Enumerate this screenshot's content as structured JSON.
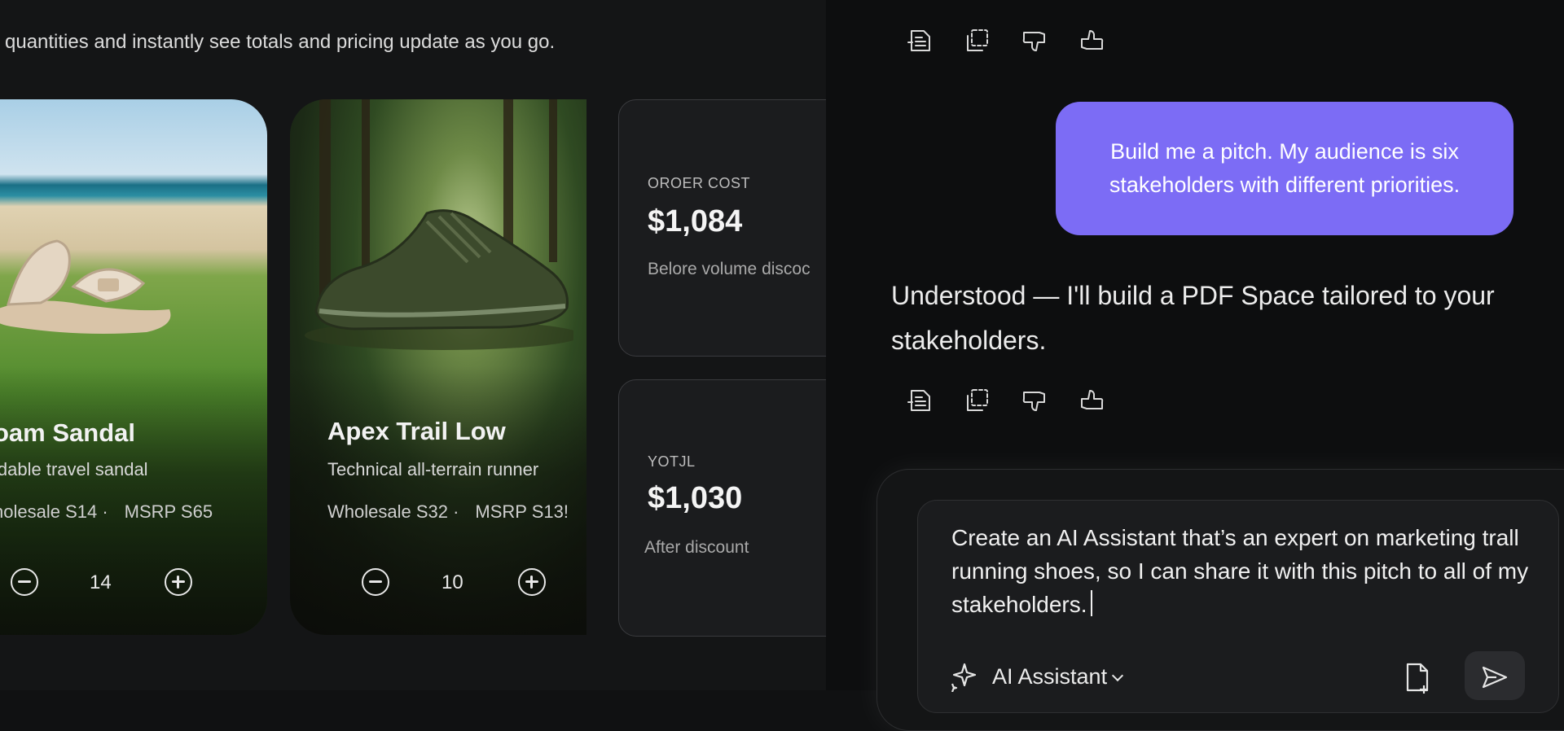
{
  "catalog": {
    "intro": "quantities and instantly see totals and pricing update as you go.",
    "products": [
      {
        "name": "oam Sandal",
        "description": "ldable travel sandal",
        "wholesale": "holesale S14 ·",
        "msrp": "MSRP S65",
        "quantity": "14"
      },
      {
        "name": "Apex Trail Low",
        "description": "Technical all-terrain runner",
        "wholesale": "Wholesale S32 ·",
        "msrp": "MSRP S13!",
        "quantity": "10"
      }
    ],
    "order_cost": {
      "label": "OROER COST",
      "value": "$1,084",
      "note": "Belore volume discoc"
    },
    "total": {
      "label": "YOTJL",
      "value": "$1,030",
      "note": "After discount"
    }
  },
  "chat": {
    "user_message": "Build me a pitch. My audience is six stakeholders with different priorities.",
    "assistant_message": "Understood — I'll build a PDF Space tailored to your stakeholders.",
    "feedback_icons": [
      "summarize-icon",
      "copy-icon",
      "thumbs-down-icon",
      "thumbs-up-icon"
    ],
    "composer": {
      "text": "Create an AI Assistant that’s an expert on marketing trall running shoes, so I can share it with this pitch to all of my stakeholders.",
      "assistant_selector": "AI Assistant"
    }
  },
  "colors": {
    "user_bubble": "#7c6cf5",
    "background": "#0d0e0f"
  }
}
